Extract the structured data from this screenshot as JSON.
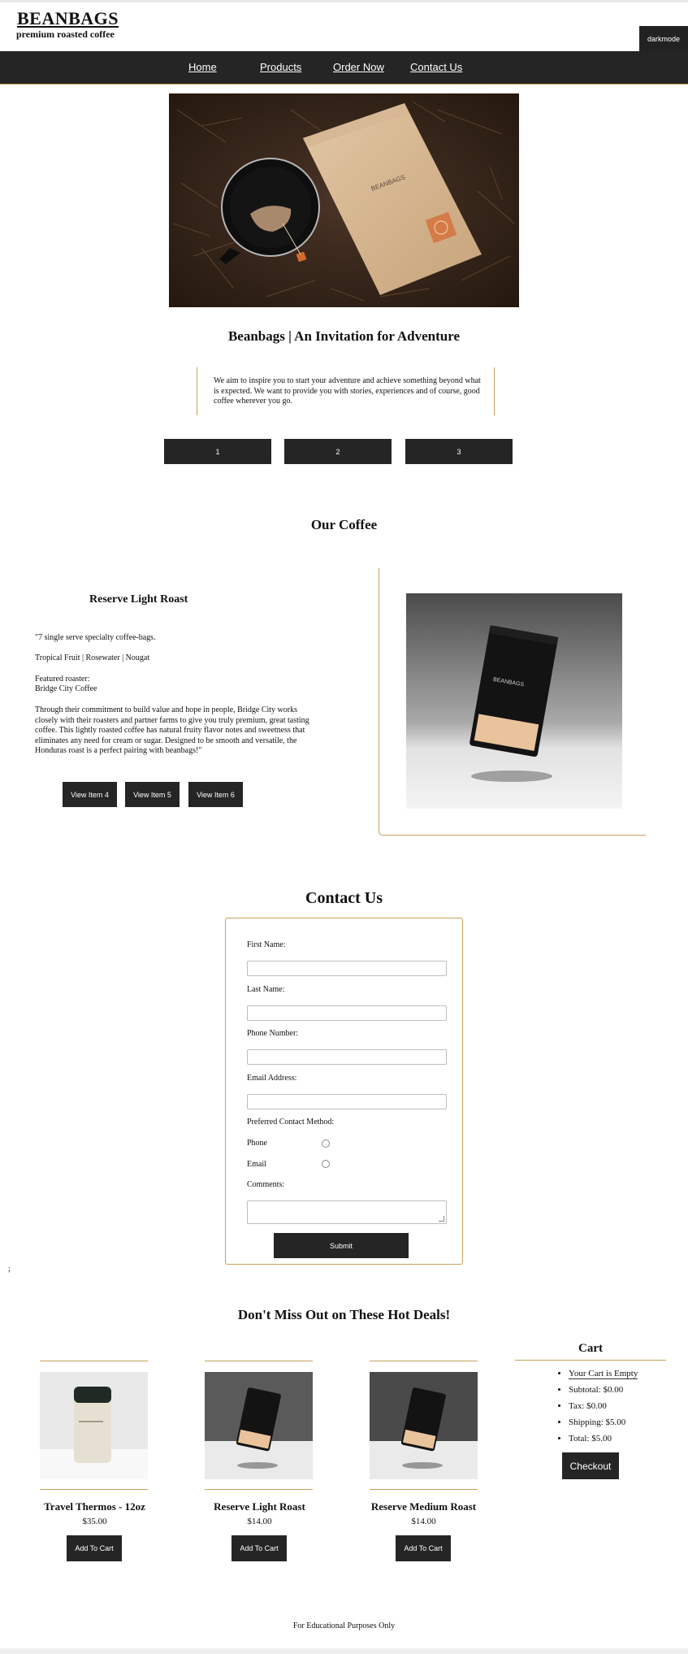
{
  "brand": {
    "title": "BEANBAGS",
    "subtitle": "premium roasted coffee"
  },
  "darkmode_label": "darkmode",
  "nav": {
    "items": [
      "Home",
      "Products",
      "Order Now",
      "Contact Us"
    ]
  },
  "hero": {
    "title": "Beanbags | An Invitation for Adventure",
    "mission": "We aim to inspire you to start your adventure and achieve something beyond what is expected. We want to provide you with stories, experiences and of course, good coffee wherever you go.",
    "slides": [
      "1",
      "2",
      "3"
    ]
  },
  "coffee": {
    "heading": "Our Coffee",
    "product": {
      "name": "Reserve Light Roast",
      "desc1": "\"7 single serve specialty coffee-bags.",
      "notes": "Tropical Fruit | Rosewater | Nougat",
      "roaster_label": "Featured roaster:",
      "roaster": "Bridge City Coffee",
      "desc2": "Through their commitment to build value and hope in people, Bridge City works closely with their roasters and partner farms to give you truly premium, great tasting coffee. This lightly roasted coffee has natural fruity flavor notes and sweetness that eliminates any need for cream or sugar. Designed to be smooth and versatile, the Honduras roast is a perfect pairing with beanbags!\""
    },
    "view_buttons": [
      "View Item 4",
      "View Item 5",
      "View Item 6"
    ]
  },
  "contact": {
    "heading": "Contact Us",
    "fields": {
      "first_name": "First Name:",
      "last_name": "Last Name:",
      "phone": "Phone Number:",
      "email": "Email Address:",
      "preferred": "Preferred Contact Method:",
      "opt_phone": "Phone",
      "opt_email": "Email",
      "comments": "Comments:"
    },
    "submit": "Submit"
  },
  "stray_char": ";",
  "deals": {
    "heading": "Don't Miss Out on These Hot Deals!",
    "items": [
      {
        "name": "Travel Thermos - 12oz",
        "price": "$35.00",
        "button": "Add To Cart"
      },
      {
        "name": "Reserve Light Roast",
        "price": "$14.00",
        "button": "Add To Cart"
      },
      {
        "name": "Reserve Medium Roast",
        "price": "$14.00",
        "button": "Add To Cart"
      }
    ]
  },
  "cart": {
    "title": "Cart",
    "empty": "Your Cart is Empty",
    "subtotal": "Subtotal: $0.00",
    "tax": "Tax: $0.00",
    "shipping": "Shipping: $5.00",
    "total": "Total: $5.00",
    "checkout": "Checkout"
  },
  "footer": "For Educational Purposes Only",
  "colors": {
    "nav_bg": "#252525",
    "accent_gold": "#c9a15a",
    "button_bg": "#252525"
  }
}
